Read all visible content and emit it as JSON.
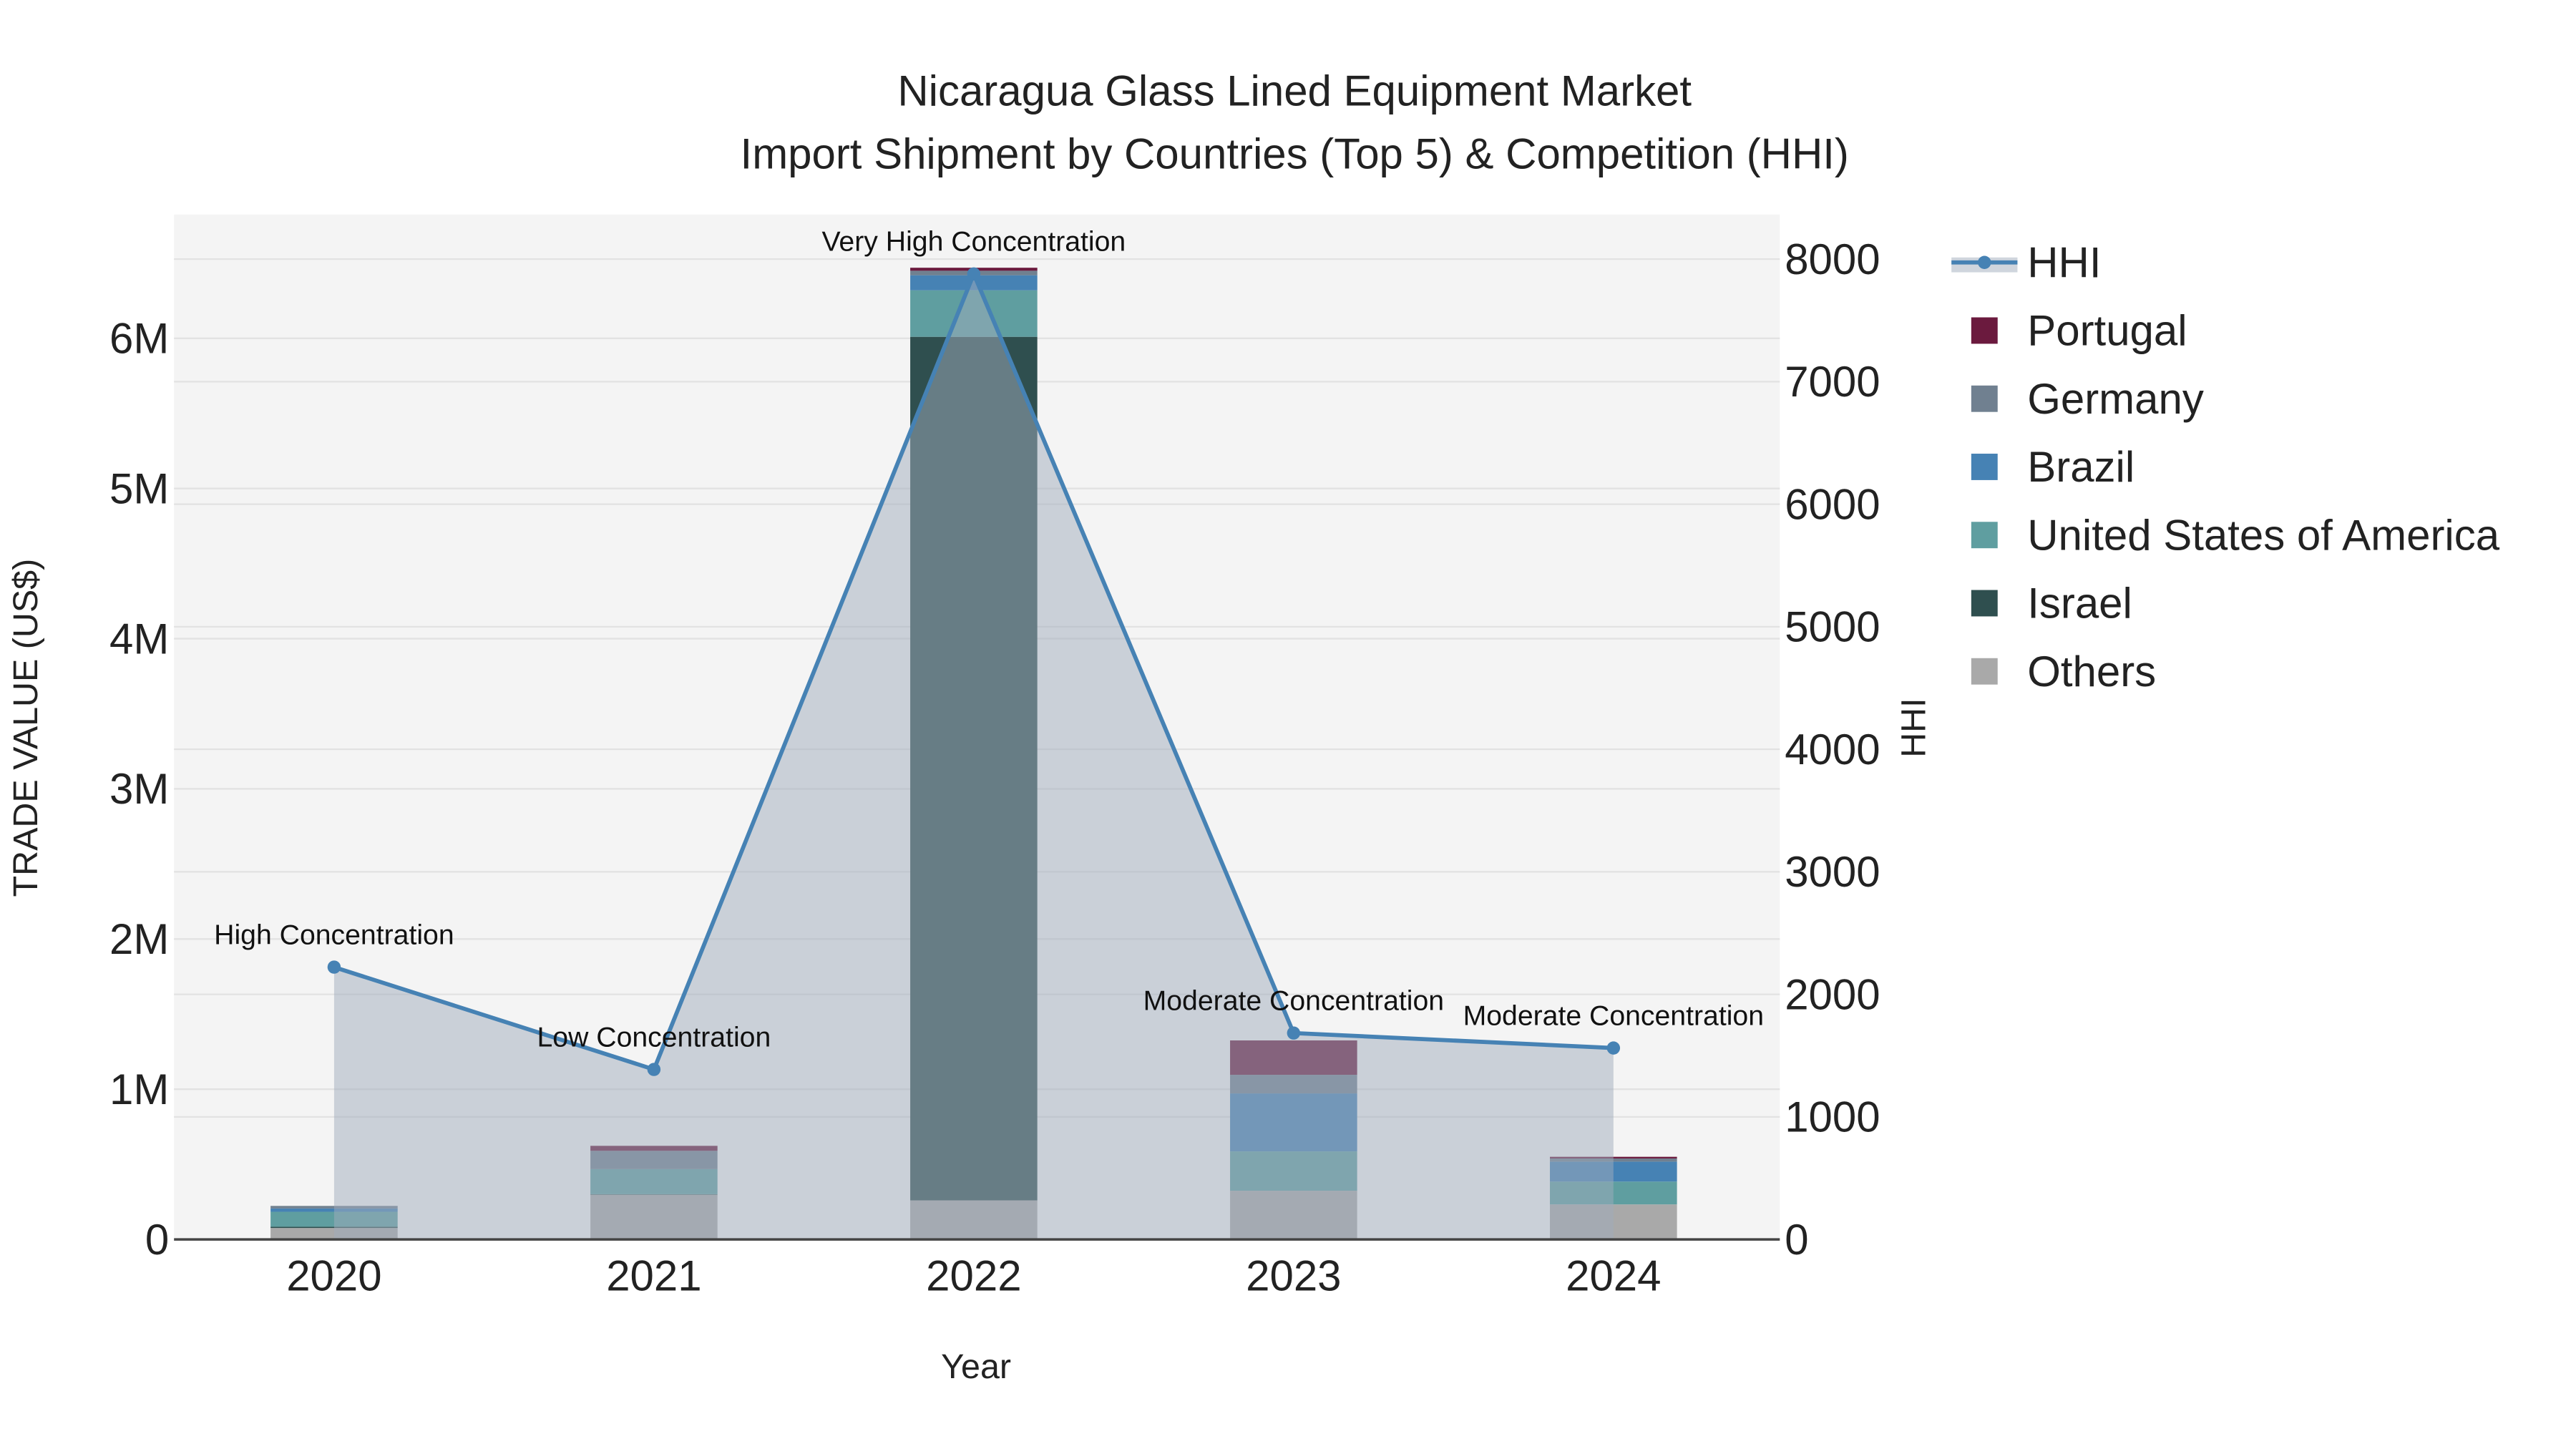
{
  "chart_data": {
    "type": "bar",
    "title": "Nicaragua Glass Lined Equipment Market",
    "subtitle": "Import Shipment by Countries (Top 5) & Competition (HHI)",
    "xlabel": "Year",
    "ylabel": "TRADE VALUE (US$)",
    "y2label": "HHI",
    "categories": [
      "2020",
      "2021",
      "2022",
      "2023",
      "2024"
    ],
    "ylim": [
      0,
      6800000
    ],
    "y2lim": [
      0,
      8300
    ],
    "yticks": [
      0,
      1000000,
      2000000,
      3000000,
      4000000,
      5000000,
      6000000
    ],
    "ytick_labels": [
      "0",
      "1M",
      "2M",
      "3M",
      "4M",
      "5M",
      "6M"
    ],
    "y2ticks": [
      0,
      1000,
      2000,
      3000,
      4000,
      5000,
      6000,
      7000,
      8000
    ],
    "y2tick_labels": [
      "0",
      "1000",
      "2000",
      "3000",
      "4000",
      "5000",
      "6000",
      "7000",
      "8000"
    ],
    "grid": true,
    "legend_position": "right",
    "series": [
      {
        "name": "Others",
        "color": "#a9a9a9",
        "values": [
          76000,
          298000,
          260000,
          324000,
          233000
        ]
      },
      {
        "name": "Israel",
        "color": "#2f4f4f",
        "values": [
          8000,
          3000,
          5750000,
          0,
          0
        ]
      },
      {
        "name": "United States of America",
        "color": "#5f9ea0",
        "values": [
          100000,
          167000,
          310000,
          262000,
          152000
        ]
      },
      {
        "name": "Brazil",
        "color": "#4682b4",
        "values": [
          22000,
          0,
          100000,
          386000,
          133000
        ]
      },
      {
        "name": "Germany",
        "color": "#708090",
        "values": [
          17000,
          122000,
          30000,
          124000,
          21000
        ]
      },
      {
        "name": "Portugal",
        "color": "#6b1a3e",
        "values": [
          0,
          33000,
          20000,
          229000,
          11000
        ]
      }
    ],
    "hhi": {
      "name": "HHI",
      "color": "#4682b4",
      "values": [
        2222,
        1387,
        7879,
        1684,
        1562
      ],
      "annotations": [
        "High Concentration",
        "Low Concentration",
        "Very High Concentration",
        "Moderate Concentration",
        "Moderate Concentration"
      ]
    },
    "legend": [
      "HHI",
      "Portugal",
      "Germany",
      "Brazil",
      "United States of America",
      "Israel",
      "Others"
    ]
  }
}
